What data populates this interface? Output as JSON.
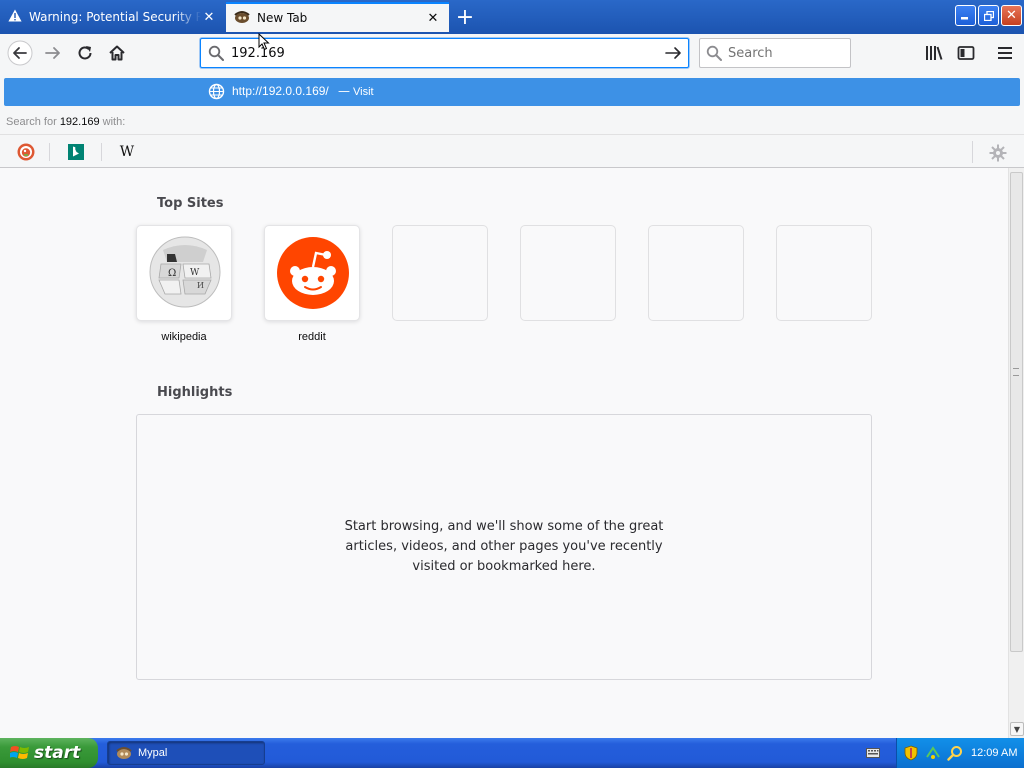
{
  "tabs": [
    {
      "title": "Warning: Potential Security Risk Ahead",
      "icon": "warning-icon",
      "active": false
    },
    {
      "title": "New Tab",
      "icon": "mypal-icon",
      "active": true
    }
  ],
  "toolbar": {
    "url_value": "192.169",
    "search_placeholder": "Search"
  },
  "autocomplete": {
    "suggestion_url": "http://192.0.0.169/",
    "suggestion_separator": "—",
    "suggestion_action": "Visit",
    "search_for_prefix": "Search for",
    "search_for_query": "192.169",
    "search_for_suffix": "with:",
    "engines": [
      "duckduckgo",
      "bing",
      "wikipedia"
    ],
    "wiki_glyph": "W"
  },
  "content": {
    "top_sites_title": "Top Sites",
    "top_sites": [
      {
        "label": "wikipedia"
      },
      {
        "label": "reddit"
      },
      {
        "label": ""
      },
      {
        "label": ""
      },
      {
        "label": ""
      },
      {
        "label": ""
      }
    ],
    "highlights_title": "Highlights",
    "highlights_empty": "Start browsing, and we'll show some of the great articles, videos, and other pages you've recently visited or bookmarked here."
  },
  "taskbar": {
    "start_label": "start",
    "task_label": "Mypal",
    "clock": "12:09 AM"
  },
  "colors": {
    "accent": "#0a84ff",
    "suggestion_bg": "#3d91e6",
    "reddit_orange": "#ff4500"
  }
}
